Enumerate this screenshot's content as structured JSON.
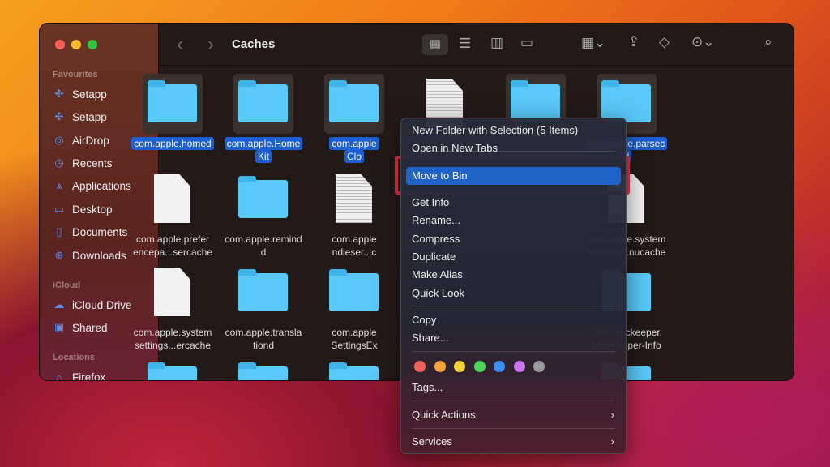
{
  "window": {
    "title": "Caches"
  },
  "toolbar": {
    "back": "‹",
    "forward": "›",
    "view_icons": "icon-view",
    "view_list": "list-view",
    "view_columns": "column-view",
    "view_gallery": "gallery-view",
    "group": "group-by",
    "share": "share",
    "tags": "tag",
    "more": "more",
    "search": "search"
  },
  "sidebar": {
    "sections": [
      {
        "title": "Favourites",
        "items": [
          {
            "label": "Setapp",
            "icon": "setapp-icon"
          },
          {
            "label": "Setapp",
            "icon": "setapp-icon"
          },
          {
            "label": "AirDrop",
            "icon": "airdrop-icon"
          },
          {
            "label": "Recents",
            "icon": "clock-icon"
          },
          {
            "label": "Applications",
            "icon": "applications-icon"
          },
          {
            "label": "Desktop",
            "icon": "desktop-icon"
          },
          {
            "label": "Documents",
            "icon": "document-icon"
          },
          {
            "label": "Downloads",
            "icon": "download-icon"
          }
        ]
      },
      {
        "title": "iCloud",
        "items": [
          {
            "label": "iCloud Drive",
            "icon": "cloud-icon"
          },
          {
            "label": "Shared",
            "icon": "shared-folder-icon"
          }
        ]
      },
      {
        "title": "Locations",
        "items": [
          {
            "label": "Firefox",
            "icon": "drive-icon"
          }
        ]
      }
    ]
  },
  "files": [
    [
      {
        "type": "folder",
        "selected": true,
        "label": [
          "com.apple.homed"
        ]
      },
      {
        "type": "folder",
        "selected": true,
        "label": [
          "com.apple.Home",
          "Kit"
        ]
      },
      {
        "type": "folder",
        "selected": true,
        "label": [
          "com.apple",
          "Clo"
        ]
      },
      {
        "type": "plist",
        "selected": false,
        "label": []
      },
      {
        "type": "folder",
        "selected": true,
        "label": []
      },
      {
        "type": "folder",
        "selected": true,
        "label": [
          "com.apple.parsec",
          "d"
        ]
      }
    ],
    [
      {
        "type": "file",
        "selected": false,
        "label": [
          "com.apple.prefer",
          "encepa...sercache"
        ]
      },
      {
        "type": "folder",
        "selected": false,
        "label": [
          "com.apple.remind",
          "d"
        ]
      },
      {
        "type": "plist",
        "selected": false,
        "label": [
          "com.apple",
          "ndleser...c"
        ]
      },
      null,
      null,
      {
        "type": "file",
        "selected": false,
        "label": [
          "com.apple.system",
          "settings...nucache"
        ]
      }
    ],
    [
      {
        "type": "file",
        "selected": false,
        "label": [
          "com.apple.system",
          "settings...ercache"
        ]
      },
      {
        "type": "folder",
        "selected": false,
        "label": [
          "com.apple.transla",
          "tiond"
        ]
      },
      {
        "type": "folder",
        "selected": false,
        "label": [
          "com.apple",
          "SettingsEx"
        ]
      },
      null,
      null,
      {
        "type": "folder",
        "selected": false,
        "label": [
          "com.mackeeper.",
          "MacKeeper-Info"
        ]
      }
    ],
    [
      {
        "type": "folder",
        "selected": false,
        "label": []
      },
      {
        "type": "folder",
        "selected": false,
        "label": []
      },
      {
        "type": "folder",
        "selected": false,
        "label": []
      },
      null,
      null,
      {
        "type": "folder",
        "selected": false,
        "label": []
      }
    ]
  ],
  "context_menu": {
    "items": [
      {
        "label": "New Folder with Selection (5 Items)"
      },
      {
        "label": "Open in New Tabs"
      },
      {
        "label": "Move to Bin",
        "highlighted": true
      },
      {
        "label": "Get Info"
      },
      {
        "label": "Rename..."
      },
      {
        "label": "Compress"
      },
      {
        "label": "Duplicate"
      },
      {
        "label": "Make Alias"
      },
      {
        "label": "Quick Look"
      },
      {
        "label": "Copy"
      },
      {
        "label": "Share..."
      },
      {
        "label": "Tags..."
      },
      {
        "label": "Quick Actions",
        "submenu": "›"
      },
      {
        "label": "Services",
        "submenu": "›"
      }
    ],
    "tag_colors": [
      "#f0625a",
      "#f5a43a",
      "#f5d43a",
      "#4cd55a",
      "#3a8ff5",
      "#c776ee",
      "#9a9a9e"
    ]
  },
  "annotation": {
    "color": "#e8304a"
  }
}
